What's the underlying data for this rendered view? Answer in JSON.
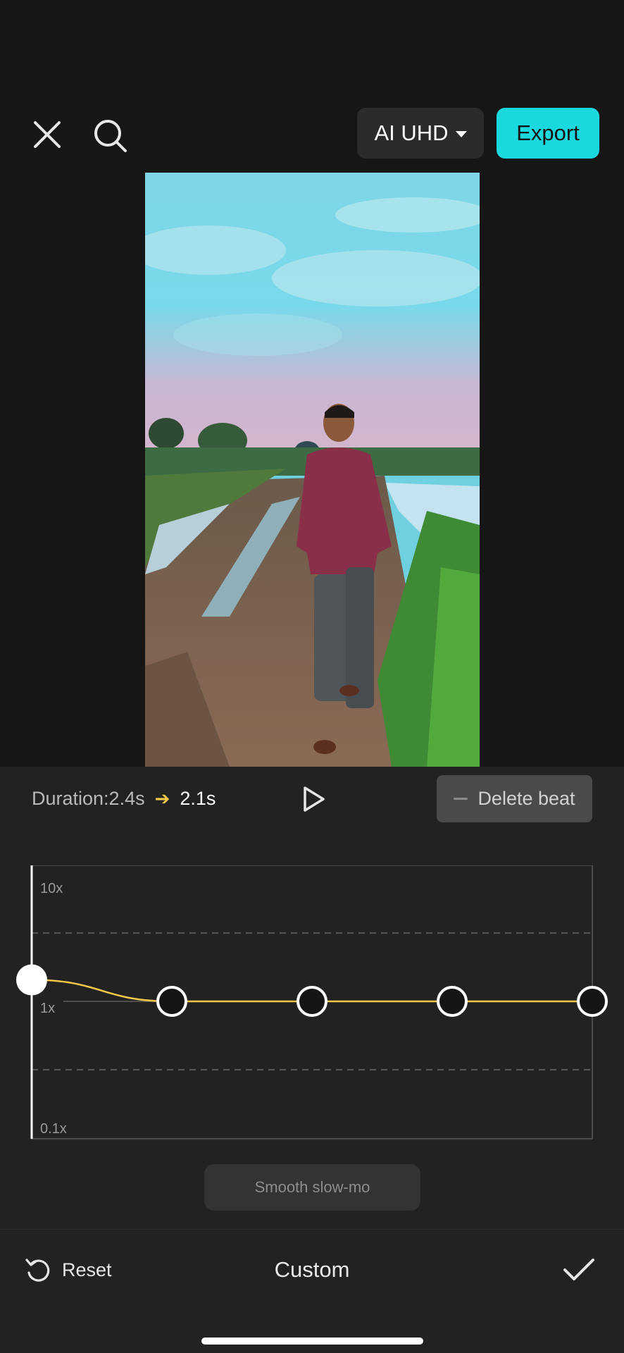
{
  "topbar": {
    "close_icon": "close-icon",
    "search_icon": "search-icon",
    "quality_label": "AI UHD",
    "export_label": "Export",
    "accent_color": "#1ad9de"
  },
  "preview": {
    "description_icon": "video-preview"
  },
  "speed_panel": {
    "duration_label": "Duration:2.4s",
    "duration_new": "2.1s",
    "play_icon": "play-icon",
    "delete_beat_label": "Delete beat",
    "axis": {
      "top": "10x",
      "mid": "1x",
      "bottom": "0.1x"
    },
    "curve_color": "#f4c84a",
    "beats": [
      {
        "position": 0.0,
        "speed": 1.5
      },
      {
        "position": 0.25,
        "speed": 1
      },
      {
        "position": 0.5,
        "speed": 1
      },
      {
        "position": 0.75,
        "speed": 1
      },
      {
        "position": 1.0,
        "speed": 1
      }
    ],
    "smooth_label": "Smooth slow-mo"
  },
  "footer": {
    "reset_label": "Reset",
    "title": "Custom",
    "confirm_icon": "checkmark-icon"
  }
}
